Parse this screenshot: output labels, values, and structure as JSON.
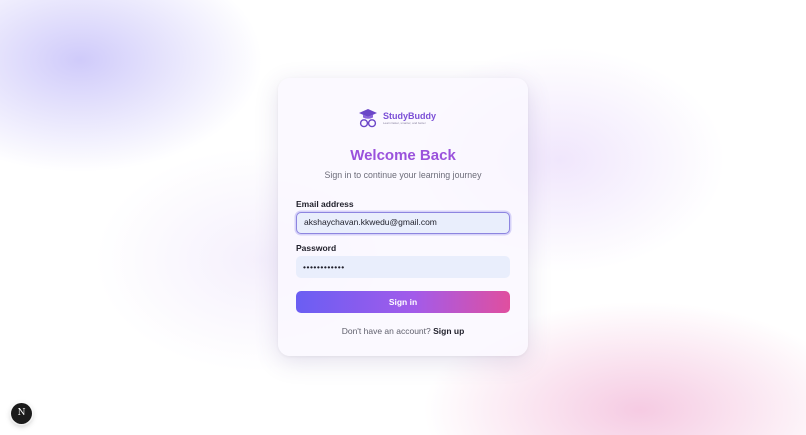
{
  "brand": {
    "name": "StudyBuddy",
    "tagline": "Learn faster, smarter, and better",
    "logo_icon": "graduation-cap-glasses-icon",
    "color": "#7b4fd6"
  },
  "login": {
    "title": "Welcome Back",
    "subtitle": "Sign in to continue your learning journey",
    "email": {
      "label": "Email address",
      "value": "akshaychavan.kkwedu@gmail.com"
    },
    "password": {
      "label": "Password",
      "masked_value": "••••••••••••"
    },
    "submit_label": "Sign in",
    "footer_text": "Don't have an account?",
    "signup_label": "Sign up"
  },
  "dev_badge": {
    "label": "N",
    "icon": "nextjs-logo-icon"
  },
  "colors": {
    "accent_start": "#6a5ef3",
    "accent_end": "#e04f9f",
    "title": "#9a52dc"
  }
}
